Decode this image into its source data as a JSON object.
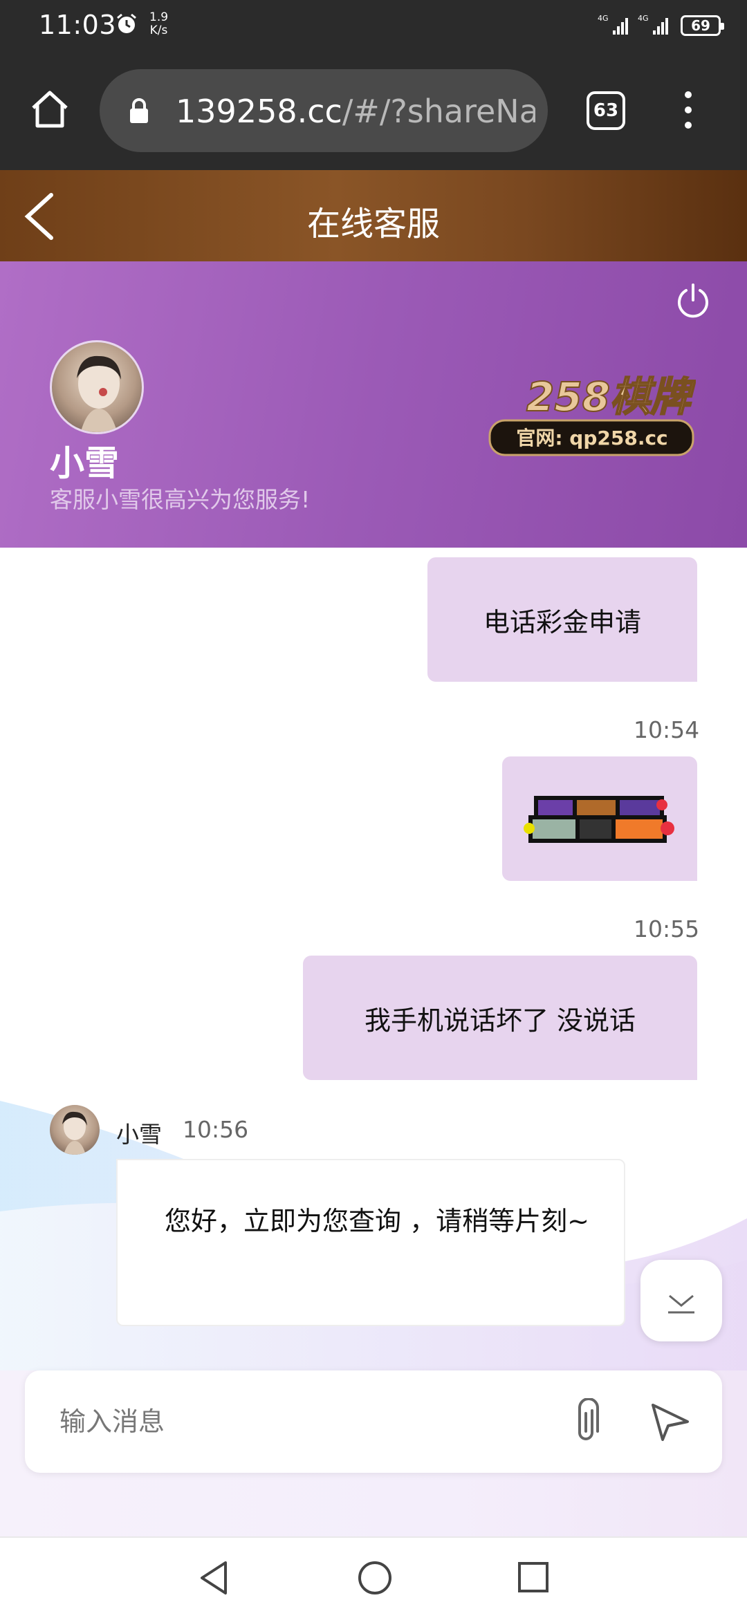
{
  "status_bar": {
    "time": "11:03",
    "net_speed_value": "1.9",
    "net_speed_unit": "K/s",
    "signal_1": "4G",
    "signal_2": "4G",
    "battery": "69"
  },
  "browser": {
    "url_host": "139258.cc",
    "url_rest": "/#/?shareNam",
    "tab_count": "63"
  },
  "header": {
    "title": "在线客服"
  },
  "banner": {
    "agent_name": "小雪",
    "slogan": "客服小雪很高兴为您服务!",
    "logo_text_top": "258棋牌",
    "logo_text_bottom": "官网: qp258.cc"
  },
  "messages": {
    "out_1": "电话彩金申请",
    "time_2": "10:54",
    "time_3": "10:55",
    "out_3": "我手机说话坏了 没说话",
    "in_sender": "小雪",
    "in_time": "10:56",
    "in_text": "您好，立即为您查询 ，请稍等片刻~"
  },
  "input": {
    "placeholder": "输入消息"
  },
  "colors": {
    "header_brown": "#7a4820",
    "banner_purple": "#9b5ab6",
    "bubble_out": "#e7d4ee"
  }
}
